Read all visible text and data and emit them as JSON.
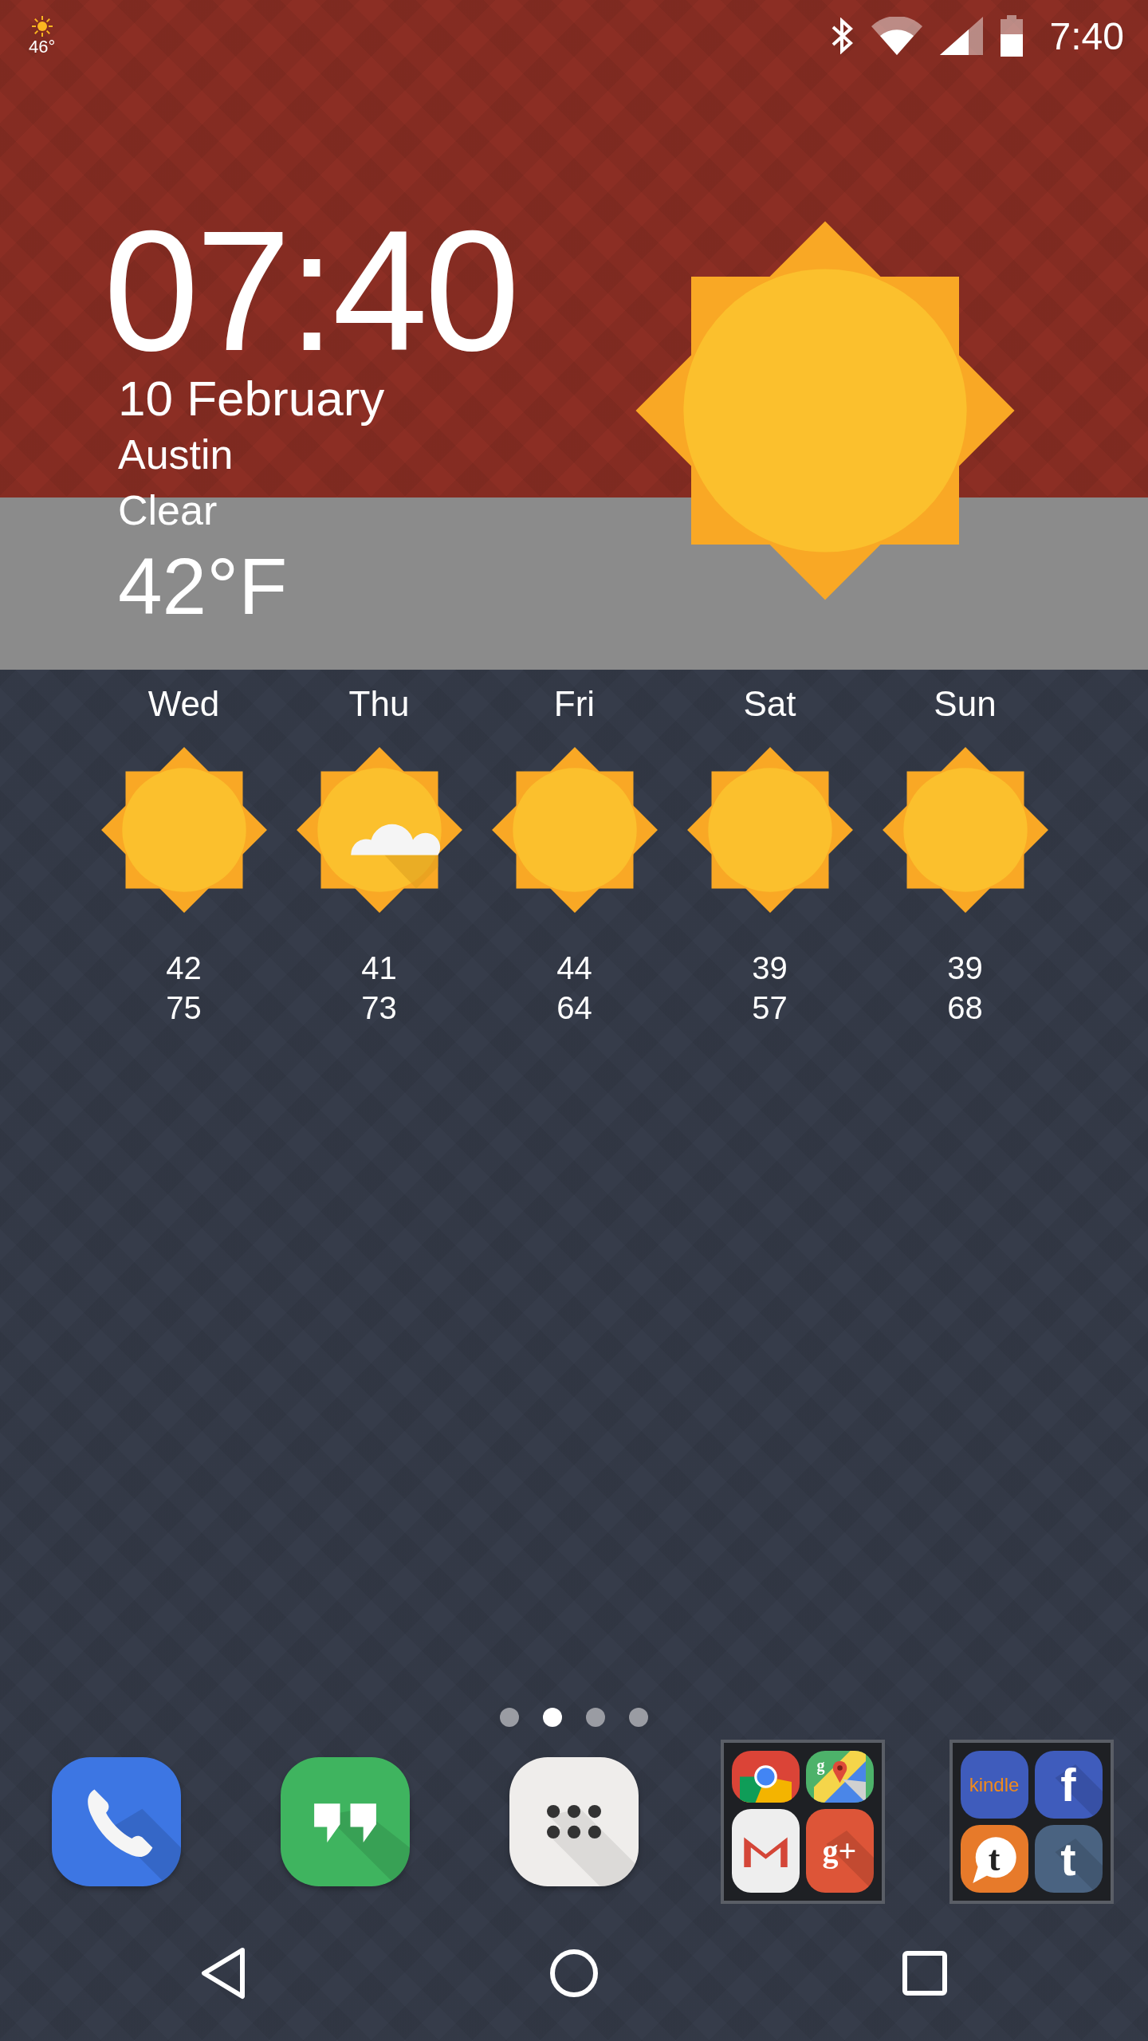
{
  "status_bar": {
    "weather_temp": "46°",
    "time": "7:40"
  },
  "clock": {
    "time": "07:40",
    "date": "10 February",
    "city": "Austin",
    "condition": "Clear",
    "temperature": "42°F",
    "kind": "sunny"
  },
  "forecast": [
    {
      "day": "Wed",
      "kind": "sunny",
      "low": "42",
      "high": "75"
    },
    {
      "day": "Thu",
      "kind": "partly_cloudy",
      "low": "41",
      "high": "73"
    },
    {
      "day": "Fri",
      "kind": "sunny",
      "low": "44",
      "high": "64"
    },
    {
      "day": "Sat",
      "kind": "sunny",
      "low": "39",
      "high": "57"
    },
    {
      "day": "Sun",
      "kind": "sunny",
      "low": "39",
      "high": "68"
    }
  ],
  "pages": [
    {
      "selected": false
    },
    {
      "selected": true
    },
    {
      "selected": false
    },
    {
      "selected": false
    }
  ],
  "dock": [
    {
      "kind": "phone"
    },
    {
      "kind": "hangouts"
    },
    {
      "kind": "launcher"
    },
    {
      "kind": "folder",
      "apps": [
        {
          "kind": "chrome"
        },
        {
          "kind": "maps",
          "glyph": "g"
        },
        {
          "kind": "gmail"
        },
        {
          "kind": "gplus",
          "glyph": "g+"
        }
      ]
    },
    {
      "kind": "folder",
      "apps": [
        {
          "kind": "kindle",
          "glyph": "kindle"
        },
        {
          "kind": "facebook",
          "glyph": "f"
        },
        {
          "kind": "tapatalk",
          "glyph": "t"
        },
        {
          "kind": "tumblr",
          "glyph": "t"
        }
      ]
    }
  ]
}
